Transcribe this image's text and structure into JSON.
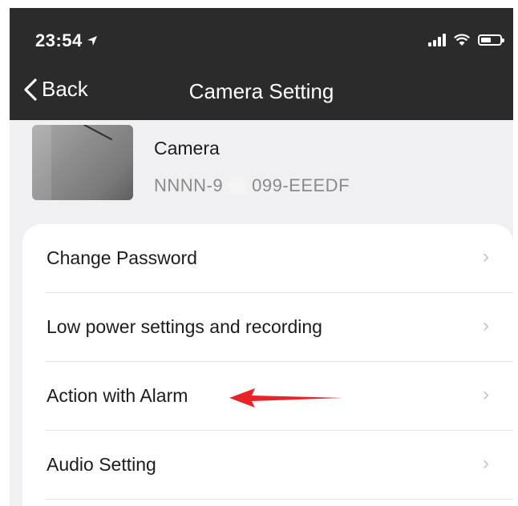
{
  "status_bar": {
    "time": "23:54",
    "location_arrow": "location-arrow-icon",
    "icons": [
      "signal-bars-icon",
      "wifi-icon",
      "battery-icon"
    ]
  },
  "nav": {
    "back_label": "Back",
    "title": "Camera Setting"
  },
  "device": {
    "name": "Camera",
    "id_prefix": "NNNN-9",
    "id_suffix": "099-EEEDF"
  },
  "menu": {
    "items": [
      {
        "label": "Change Password"
      },
      {
        "label": "Low power settings and recording"
      },
      {
        "label": "Action with Alarm"
      },
      {
        "label": "Audio Setting"
      }
    ]
  },
  "annotation": {
    "arrow_color": "#e8242a"
  },
  "colors": {
    "nav_background": "#2b2b2b",
    "page_background": "#f0f0f2",
    "chevron": "#c4c4c6"
  }
}
